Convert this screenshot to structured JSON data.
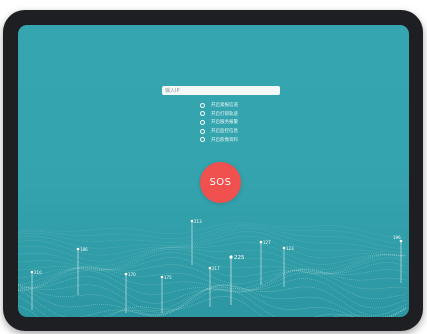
{
  "search": {
    "placeholder": "输入IP"
  },
  "options": [
    {
      "label": "开启紧报信道"
    },
    {
      "label": "开启打锁轨迹"
    },
    {
      "label": "开启服务报警"
    },
    {
      "label": "开启监控信息"
    },
    {
      "label": "开启影像资料"
    }
  ],
  "sos": {
    "label": "SOS",
    "color": "#f0504e"
  },
  "markers": [
    {
      "label": "213"
    },
    {
      "label": "186"
    },
    {
      "label": "127"
    },
    {
      "label": "225"
    },
    {
      "label": "123"
    },
    {
      "label": "217"
    },
    {
      "label": "210"
    },
    {
      "label": "170"
    },
    {
      "label": "175"
    },
    {
      "label": "196"
    }
  ],
  "colors": {
    "screen_bg": "#35a6b0",
    "bezel": "#1e1f22",
    "sos": "#f0504e"
  }
}
